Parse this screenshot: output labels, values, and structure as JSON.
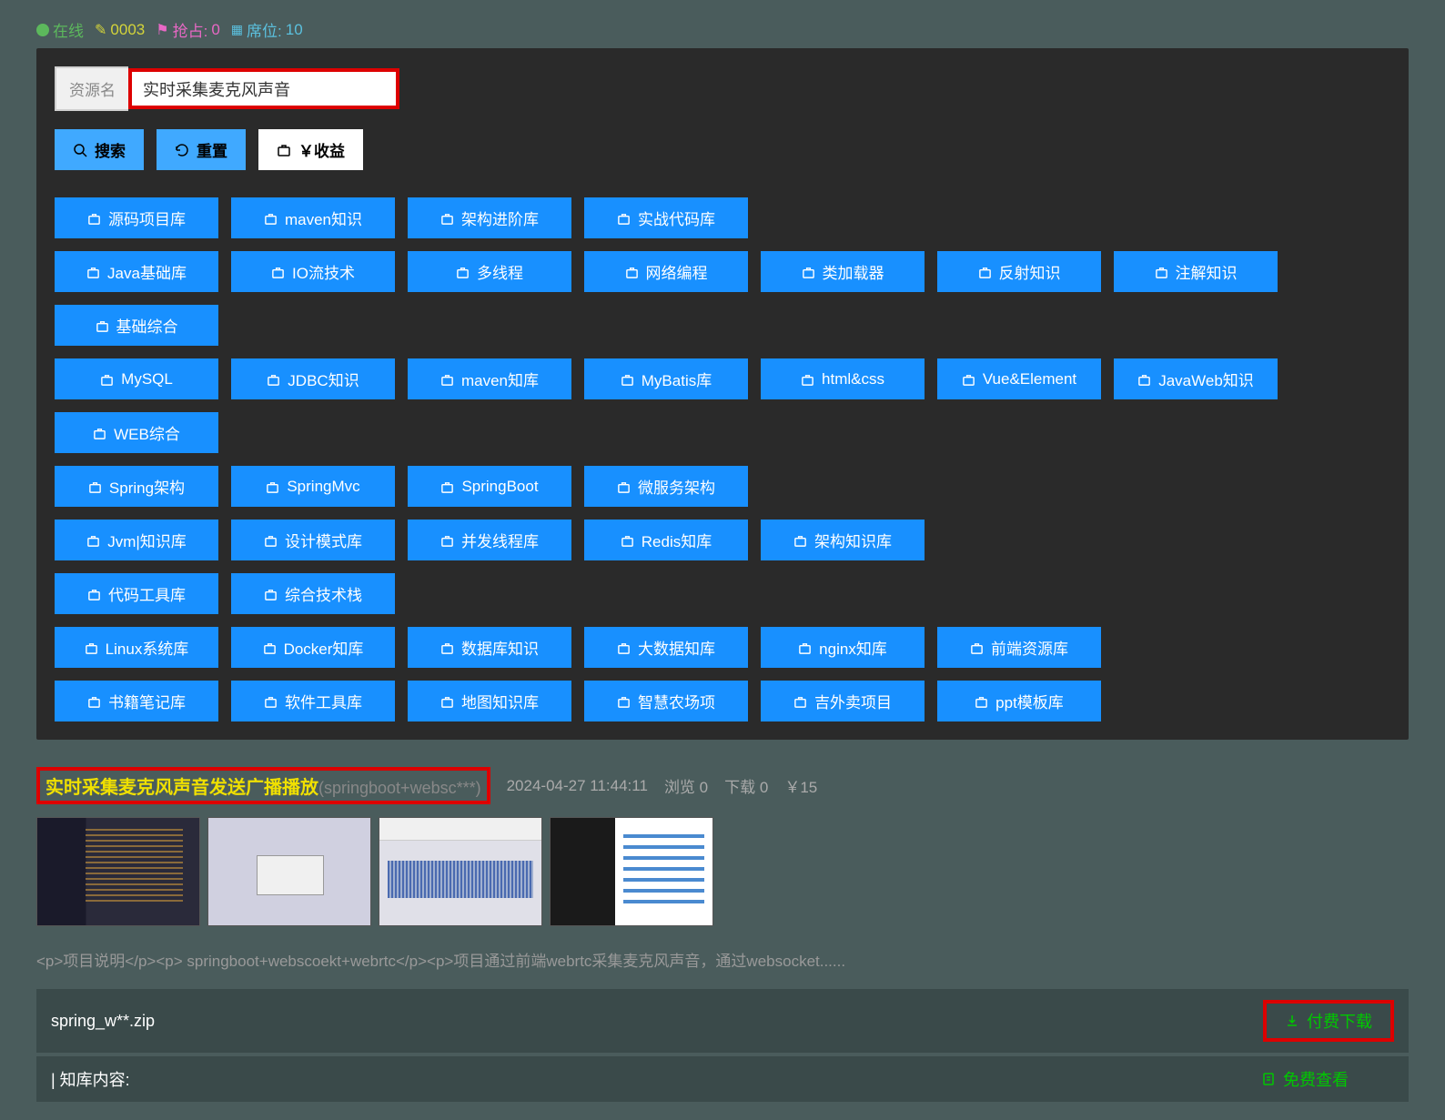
{
  "status": {
    "online": "在线",
    "edit_count": "0003",
    "grab_label": "抢占:",
    "grab_value": "0",
    "seat_label": "席位:",
    "seat_value": "10"
  },
  "search": {
    "label": "资源名",
    "value": "实时采集麦克风声音",
    "search_btn": "搜索",
    "reset_btn": "重置",
    "income_btn": "￥收益"
  },
  "tag_rows": [
    [
      "源码项目库",
      "maven知识",
      "架构进阶库",
      "实战代码库"
    ],
    [
      "Java基础库",
      "IO流技术",
      "多线程",
      "网络编程",
      "类加载器",
      "反射知识",
      "注解知识",
      "基础综合"
    ],
    [
      "MySQL",
      "JDBC知识",
      "maven知库",
      "MyBatis库",
      "html&css",
      "Vue&Element",
      "JavaWeb知识",
      "WEB综合"
    ],
    [
      "Spring架构",
      "SpringMvc",
      "SpringBoot",
      "微服务架构"
    ],
    [
      "Jvm|知识库",
      "设计模式库",
      "并发线程库",
      "Redis知库",
      "架构知识库"
    ],
    [
      "代码工具库",
      "综合技术栈"
    ],
    [
      "Linux系统库",
      "Docker知库",
      "数据库知识",
      "大数据知库",
      "nginx知库",
      "前端资源库"
    ],
    [
      "书籍笔记库",
      "软件工具库",
      "地图知识库",
      "智慧农场项",
      "吉外卖项目",
      "ppt模板库"
    ]
  ],
  "result": {
    "title": "实时采集麦克风声音发送广播播放",
    "subtitle": "(springboot+websc***)",
    "date": "2024-04-27 11:44:11",
    "views_label": "浏览",
    "views": "0",
    "downloads_label": "下载",
    "downloads": "0",
    "price": "￥15",
    "description": "<p>项目说明</p><p> springboot+webscoekt+webrtc</p><p>项目通过前端webrtc采集麦克风声音，通过websocket......",
    "filename": "spring_w**.zip",
    "download_btn": "付费下载",
    "content_label": "| 知库内容:",
    "view_btn": "免费查看"
  }
}
